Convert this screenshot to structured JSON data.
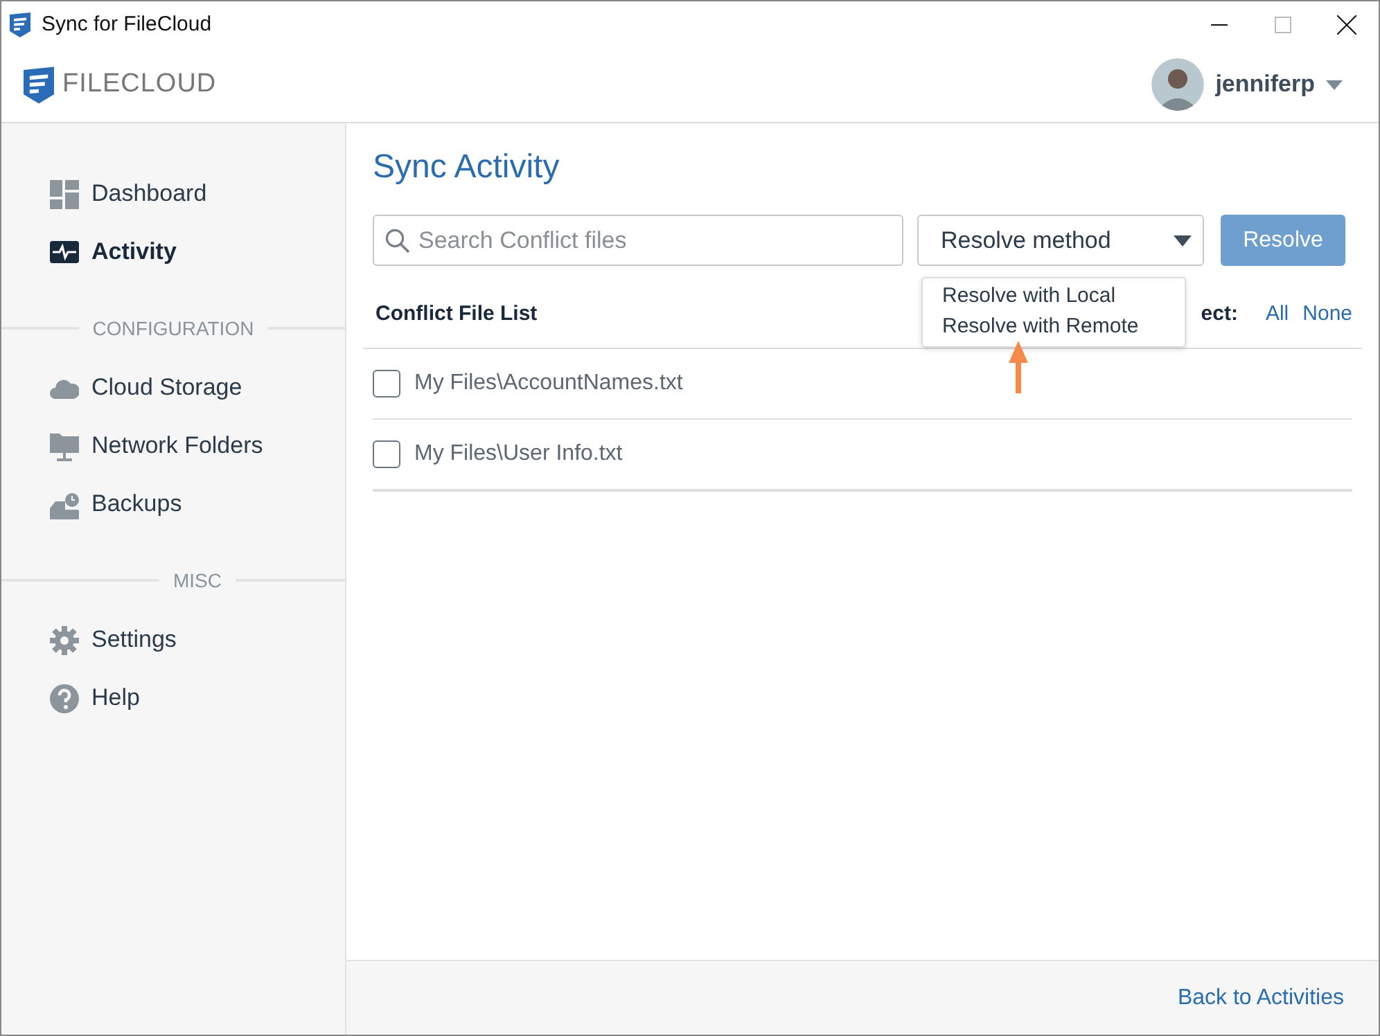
{
  "window": {
    "title": "Sync for FileCloud"
  },
  "header": {
    "logo": "FILECLOUD",
    "user": "jenniferp"
  },
  "sidebar": {
    "sections": [
      {
        "items": [
          {
            "label": "Dashboard",
            "selected": false
          },
          {
            "label": "Activity",
            "selected": true
          }
        ]
      },
      {
        "heading": "CONFIGURATION",
        "items": [
          {
            "label": "Cloud Storage",
            "selected": false
          },
          {
            "label": "Network Folders",
            "selected": false
          },
          {
            "label": "Backups",
            "selected": false
          }
        ]
      },
      {
        "heading": "MISC",
        "items": [
          {
            "label": "Settings",
            "selected": false
          },
          {
            "label": "Help",
            "selected": false
          }
        ]
      }
    ]
  },
  "main": {
    "title": "Sync Activity",
    "search": {
      "placeholder": "Search Conflict files"
    },
    "resolve_method": {
      "label": "Resolve method",
      "expanded": true,
      "options": [
        "Resolve with Local",
        "Resolve with Remote"
      ]
    },
    "resolve_button": {
      "label": "Resolve",
      "disabled": true
    },
    "list_title": "Conflict File List",
    "select": {
      "label": "ect:",
      "links": [
        "All",
        "None"
      ]
    },
    "files": [
      {
        "name": "My Files\\AccountNames.txt",
        "checked": false
      },
      {
        "name": "My Files\\User Info.txt",
        "checked": false
      }
    ]
  },
  "footer": {
    "link": "Back to Activities"
  }
}
